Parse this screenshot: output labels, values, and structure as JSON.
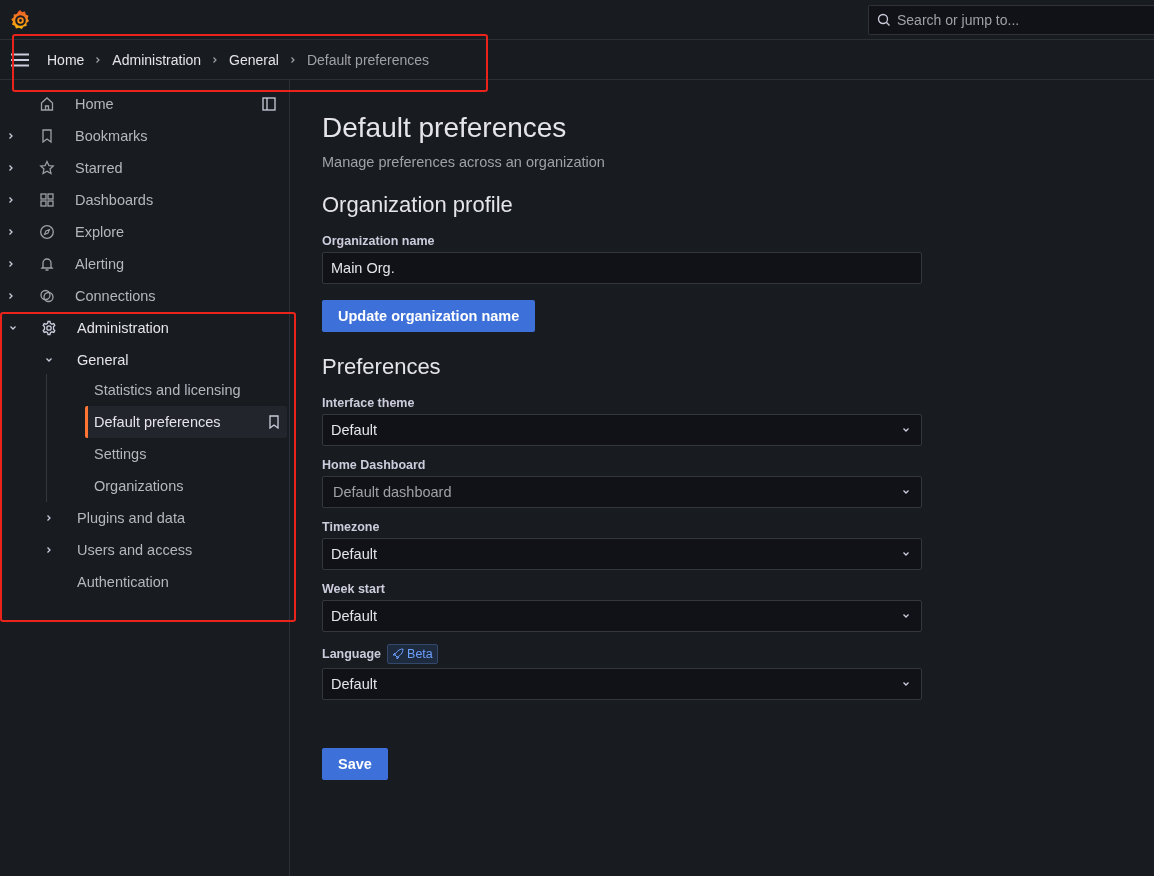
{
  "search": {
    "placeholder": "Search or jump to..."
  },
  "breadcrumb": {
    "highlighted": true,
    "items": [
      "Home",
      "Administration",
      "General",
      "Default preferences"
    ]
  },
  "nav": [
    {
      "label": "Home",
      "kind": "link",
      "selected": false
    },
    {
      "label": "Bookmarks",
      "kind": "expandable",
      "expanded": false,
      "selected": false
    },
    {
      "label": "Starred",
      "kind": "expandable",
      "expanded": false,
      "selected": false
    },
    {
      "label": "Dashboards",
      "kind": "expandable",
      "expanded": false,
      "selected": false
    },
    {
      "label": "Explore",
      "kind": "expandable",
      "expanded": false,
      "selected": false
    },
    {
      "label": "Alerting",
      "kind": "expandable",
      "expanded": false,
      "selected": false
    },
    {
      "label": "Connections",
      "kind": "expandable",
      "expanded": false,
      "selected": false
    },
    {
      "label": "Administration",
      "kind": "expandable",
      "expanded": true,
      "selected": false,
      "highlighted": true,
      "children": [
        {
          "label": "General",
          "kind": "expandable",
          "expanded": true,
          "selected": false,
          "children": [
            {
              "label": "Statistics and licensing",
              "selected": false
            },
            {
              "label": "Default preferences",
              "selected": true
            },
            {
              "label": "Settings",
              "selected": false
            },
            {
              "label": "Organizations",
              "selected": false
            }
          ]
        },
        {
          "label": "Plugins and data",
          "kind": "expandable",
          "expanded": false,
          "selected": false
        },
        {
          "label": "Users and access",
          "kind": "expandable",
          "expanded": false,
          "selected": false
        },
        {
          "label": "Authentication",
          "kind": "link",
          "selected": false
        }
      ]
    }
  ],
  "page": {
    "title": "Default preferences",
    "subtitle": "Manage preferences across an organization"
  },
  "sections": [
    {
      "heading": "Organization profile",
      "fields": [
        {
          "label": "Organization name",
          "kind": "input",
          "value": "Main Org."
        }
      ],
      "button": "Update organization name"
    },
    {
      "heading": "Preferences",
      "fields": [
        {
          "label": "Interface theme",
          "kind": "select",
          "value": "Default"
        },
        {
          "label": "Home Dashboard",
          "kind": "select",
          "placeholder": "Default dashboard"
        },
        {
          "label": "Timezone",
          "kind": "select",
          "value": "Default"
        },
        {
          "label": "Week start",
          "kind": "select",
          "value": "Default"
        },
        {
          "label": "Language",
          "kind": "select",
          "value": "Default",
          "badge": "Beta"
        }
      ],
      "button": "Save"
    }
  ]
}
